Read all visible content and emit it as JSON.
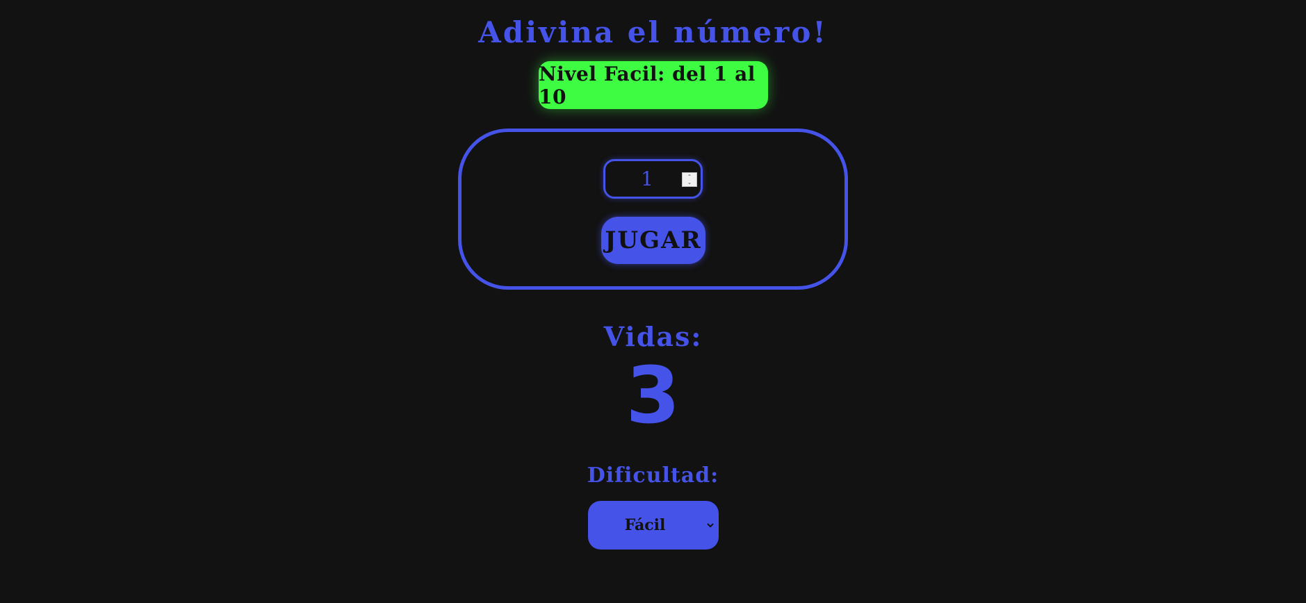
{
  "page": {
    "title": "Adivina el número!",
    "level_badge": "Nivel Facil: del 1 al 10"
  },
  "game": {
    "number_input_value": "1",
    "play_button_label": "JUGAR"
  },
  "lives": {
    "label": "Vidas:",
    "value": "3"
  },
  "difficulty": {
    "label": "Dificultad:",
    "selected": "Fácil"
  },
  "icons": {
    "spinner": "number-spinner-icon",
    "dropdown": "chevron-down-icon"
  },
  "colors": {
    "background": "#121212",
    "accent": "#4553e8",
    "level_badge": "#3efc42"
  }
}
